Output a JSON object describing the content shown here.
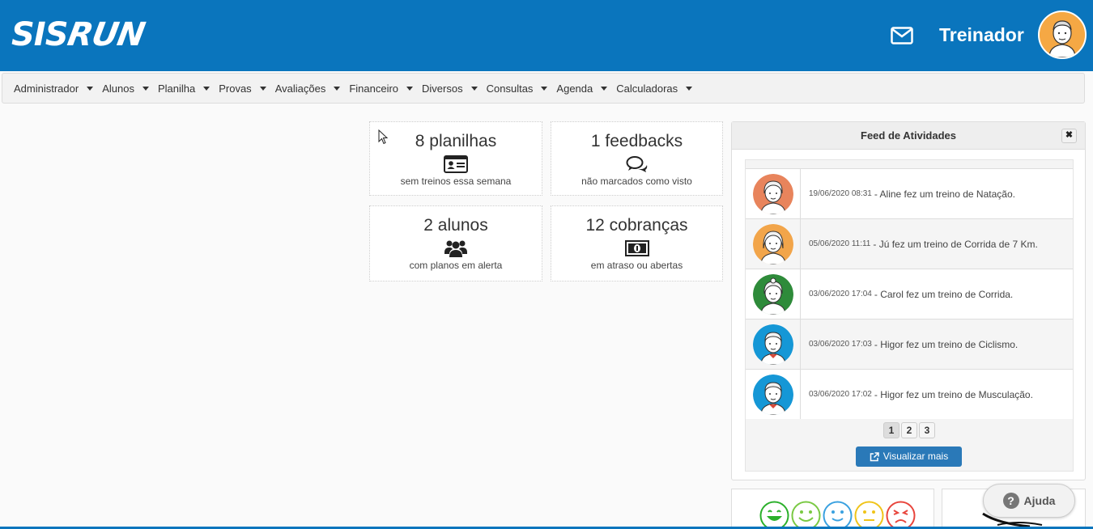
{
  "header": {
    "logo_left": "SIS",
    "logo_right": "RUN",
    "user_name": "Treinador"
  },
  "nav": {
    "items": [
      "Administrador",
      "Alunos",
      "Planilha",
      "Provas",
      "Avaliações",
      "Financeiro",
      "Diversos",
      "Consultas",
      "Agenda",
      "Calculadoras"
    ]
  },
  "cards": [
    {
      "count": "8 planilhas",
      "icon": "id-card-icon",
      "desc": "sem treinos essa semana"
    },
    {
      "count": "1 feedbacks",
      "icon": "comments-icon",
      "desc": "não marcados como visto"
    },
    {
      "count": "2 alunos",
      "icon": "users-icon",
      "desc": "com planos em alerta"
    },
    {
      "count": "12 cobranças",
      "icon": "money-icon",
      "desc": "em atraso ou abertas"
    }
  ],
  "feed": {
    "title": "Feed de Atividades",
    "close_label": "✖",
    "rows": [
      {
        "date": "19/06/2020 08:31",
        "text": "- Aline fez um treino de Natação.",
        "avatar_color": "#e8845c"
      },
      {
        "date": "05/06/2020 11:11",
        "text": "- Jú fez um treino de Corrida de 7 Km.",
        "avatar_color": "#f2a54a"
      },
      {
        "date": "03/06/2020 17:04",
        "text": "- Carol fez um treino de Corrida.",
        "avatar_color": "#2e8b3a"
      },
      {
        "date": "03/06/2020 17:03",
        "text": "- Higor fez um treino de Ciclismo.",
        "avatar_color": "#1597d6"
      },
      {
        "date": "03/06/2020 17:02",
        "text": "- Higor fez um treino de Musculação.",
        "avatar_color": "#1597d6"
      }
    ],
    "pages": [
      "1",
      "2",
      "3"
    ],
    "active_page": "1",
    "view_more_label": "Visualizar mais"
  },
  "help": {
    "label": "Ajuda",
    "icon_glyph": "?"
  },
  "colors": {
    "brand": "#0a75bd",
    "button": "#2a79b8",
    "smileys": [
      "#2bb02b",
      "#7ac943",
      "#3aa1e0",
      "#f0c419",
      "#e8453c"
    ]
  }
}
